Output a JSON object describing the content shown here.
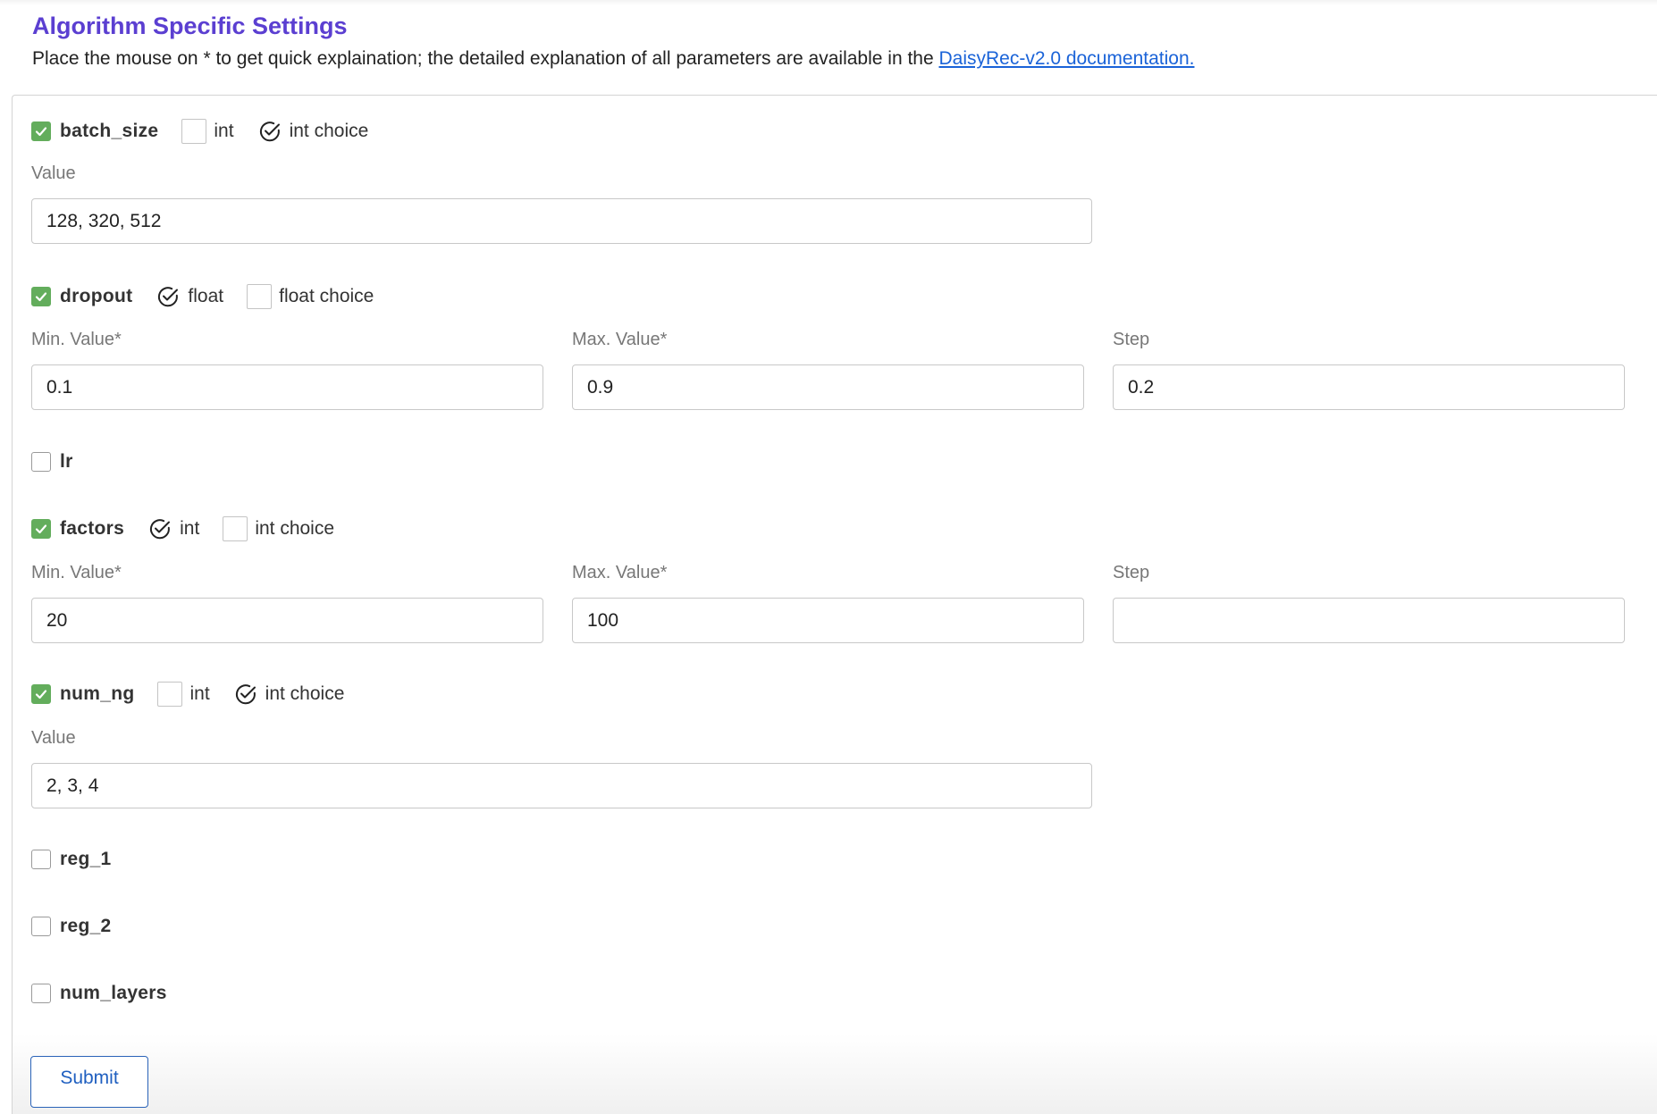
{
  "header": {
    "title": "Algorithm Specific Settings",
    "intro_text": "Place the mouse on * to get quick explaination; the detailed explanation of all parameters are available in the ",
    "doc_link": "DaisyRec-v2.0 documentation."
  },
  "params": {
    "batch_size": {
      "name": "batch_size",
      "enabled": true,
      "opt1": "int",
      "opt2": "int choice",
      "selected": "int choice",
      "value_label": "Value",
      "value": "128, 320, 512"
    },
    "dropout": {
      "name": "dropout",
      "enabled": true,
      "opt1": "float",
      "opt2": "float choice",
      "selected": "float",
      "min_label": "Min. Value*",
      "min": "0.1",
      "max_label": "Max. Value*",
      "max": "0.9",
      "step_label": "Step",
      "step": "0.2"
    },
    "lr": {
      "name": "lr",
      "enabled": false
    },
    "factors": {
      "name": "factors",
      "enabled": true,
      "opt1": "int",
      "opt2": "int choice",
      "selected": "int",
      "min_label": "Min. Value*",
      "min": "20",
      "max_label": "Max. Value*",
      "max": "100",
      "step_label": "Step",
      "step": ""
    },
    "num_ng": {
      "name": "num_ng",
      "enabled": true,
      "opt1": "int",
      "opt2": "int choice",
      "selected": "int choice",
      "value_label": "Value",
      "value": "2, 3, 4"
    },
    "reg_1": {
      "name": "reg_1",
      "enabled": false
    },
    "reg_2": {
      "name": "reg_2",
      "enabled": false
    },
    "num_layers": {
      "name": "num_layers",
      "enabled": false
    }
  },
  "submit_label": "Submit",
  "colors": {
    "title": "#5b3fd1",
    "link": "#1a63d8",
    "check": "#63ad5c",
    "submit": "#1f5fc0"
  },
  "icons": {
    "checked": "check-icon",
    "option_selected": "check-circle-icon"
  }
}
